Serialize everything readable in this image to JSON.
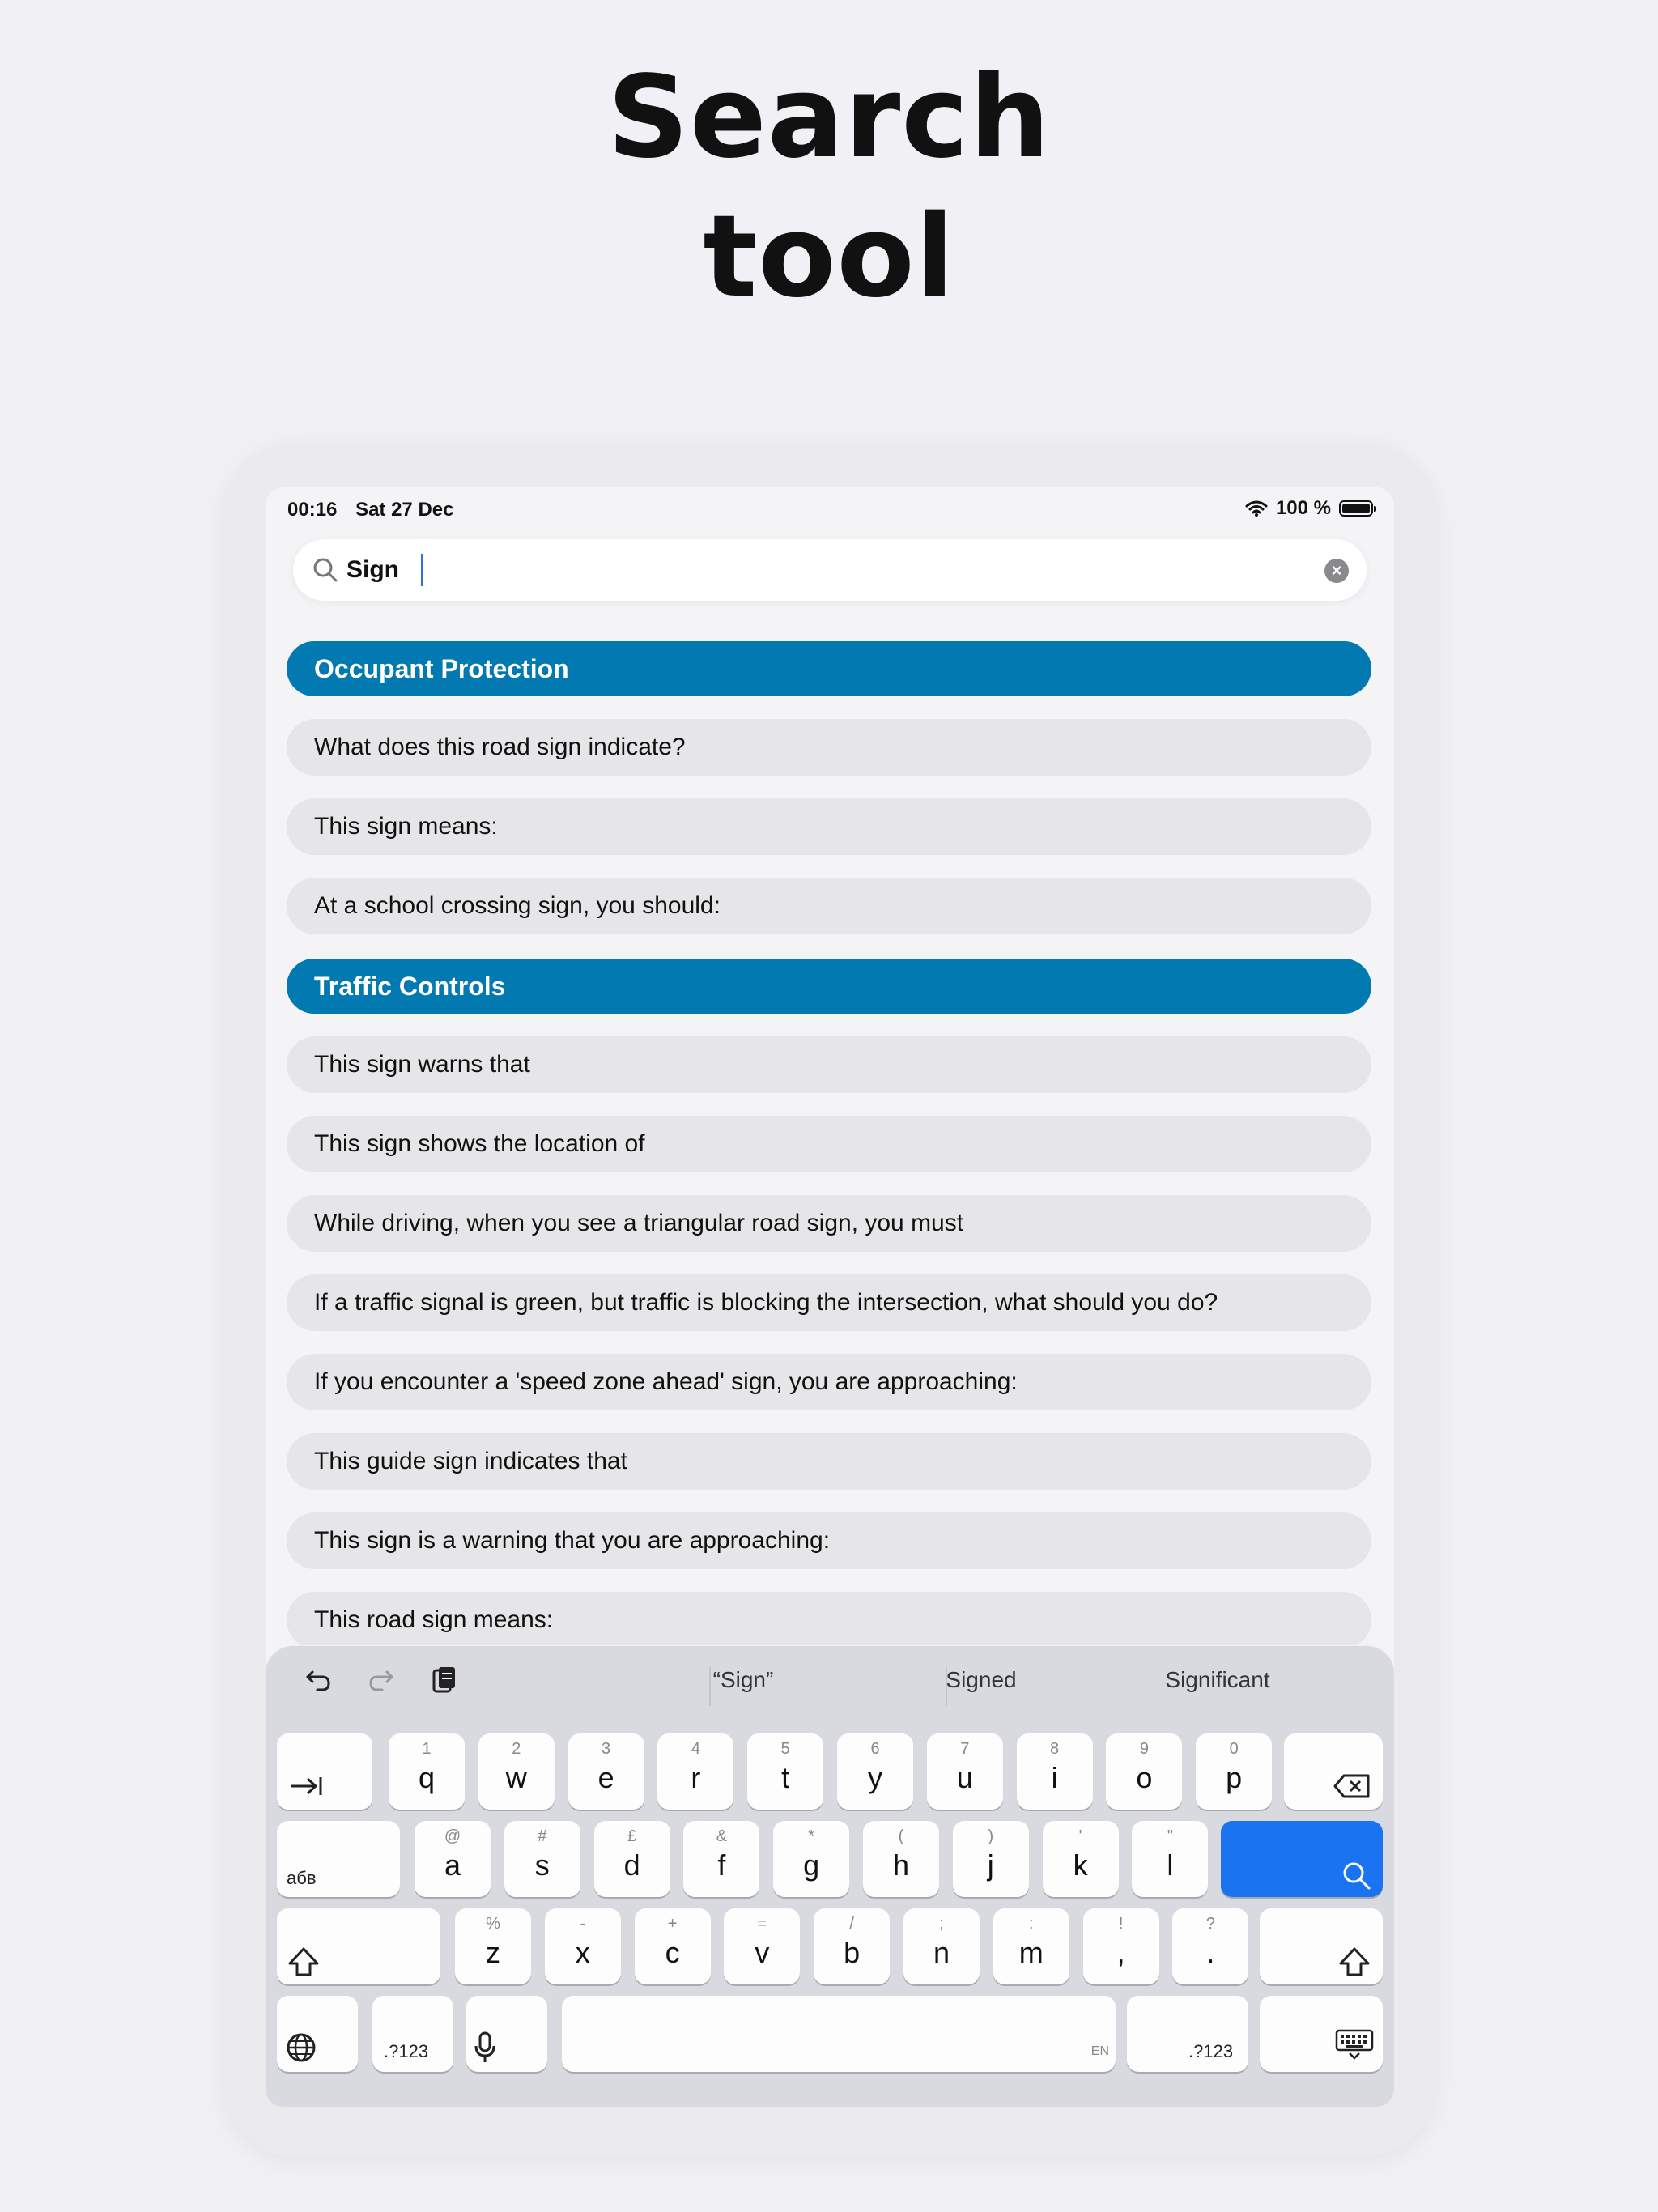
{
  "headline": {
    "line1": "Search",
    "line2": "tool"
  },
  "status_bar": {
    "time": "00:16",
    "date": "Sat 27 Dec",
    "battery": "100 %"
  },
  "search": {
    "value": "Sign"
  },
  "sections": [
    {
      "title": "Occupant Protection",
      "items": [
        "What does this road sign indicate?",
        "This sign means:",
        "At a school crossing sign, you should:"
      ]
    },
    {
      "title": "Traffic Controls",
      "items": [
        "This sign warns that",
        "This sign shows the location of",
        "While driving, when you see a triangular road sign, you must",
        "If a traffic signal is green, but traffic is blocking the intersection, what should you do?",
        "If you encounter a 'speed zone ahead' sign, you are approaching:",
        "This guide sign indicates that",
        "This sign is a warning that you are approaching:",
        "This road sign means:"
      ]
    }
  ],
  "keyboard": {
    "suggestions": [
      "“Sign”",
      "Signed",
      "Significant"
    ],
    "row1": [
      {
        "main": "q",
        "sub": "1"
      },
      {
        "main": "w",
        "sub": "2"
      },
      {
        "main": "e",
        "sub": "3"
      },
      {
        "main": "r",
        "sub": "4"
      },
      {
        "main": "t",
        "sub": "5"
      },
      {
        "main": "y",
        "sub": "6"
      },
      {
        "main": "u",
        "sub": "7"
      },
      {
        "main": "i",
        "sub": "8"
      },
      {
        "main": "o",
        "sub": "9"
      },
      {
        "main": "p",
        "sub": "0"
      }
    ],
    "row2": [
      {
        "main": "a",
        "sub": "@"
      },
      {
        "main": "s",
        "sub": "#"
      },
      {
        "main": "d",
        "sub": "£"
      },
      {
        "main": "f",
        "sub": "&"
      },
      {
        "main": "g",
        "sub": "*"
      },
      {
        "main": "h",
        "sub": "("
      },
      {
        "main": "j",
        "sub": ")"
      },
      {
        "main": "k",
        "sub": "'"
      },
      {
        "main": "l",
        "sub": "\""
      }
    ],
    "row3": [
      {
        "main": "z",
        "sub": "%"
      },
      {
        "main": "x",
        "sub": "-"
      },
      {
        "main": "c",
        "sub": "+"
      },
      {
        "main": "v",
        "sub": "="
      },
      {
        "main": "b",
        "sub": "/"
      },
      {
        "main": "n",
        "sub": ";"
      },
      {
        "main": "m",
        "sub": ":"
      },
      {
        "main": ",",
        "sub": "!"
      },
      {
        "main": ".",
        "sub": "?"
      }
    ],
    "abc_label": "абв",
    "numbers_label": ".?123",
    "space_lang": "EN",
    "icons": [
      "undo-icon",
      "redo-icon",
      "clipboard-icon",
      "tab-icon",
      "delete-icon",
      "search-icon",
      "shift-icon",
      "globe-icon",
      "mic-icon",
      "keyboard-hide-icon"
    ]
  }
}
